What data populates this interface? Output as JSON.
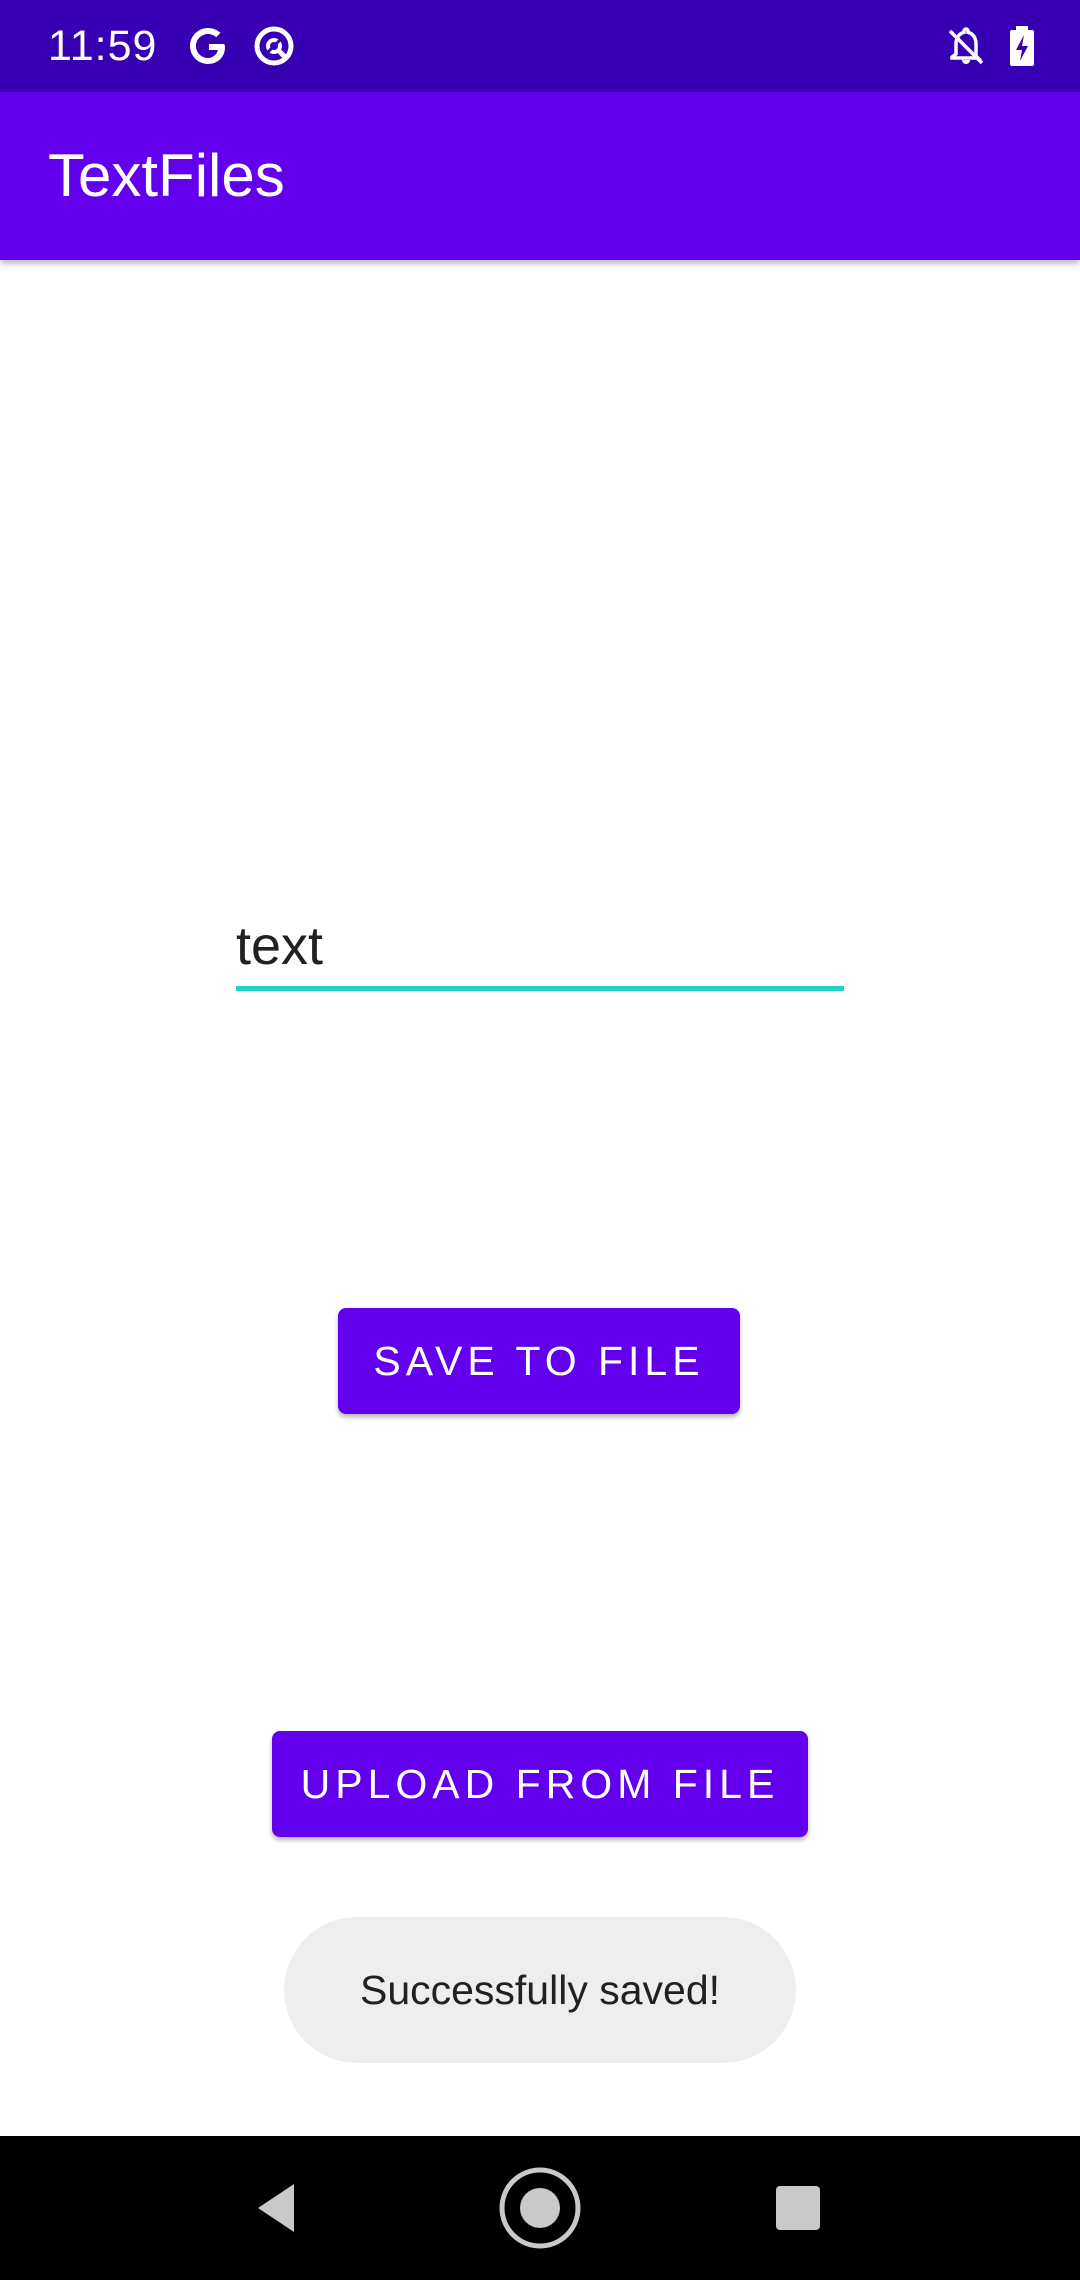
{
  "status_bar": {
    "time": "11:59",
    "left_icons": [
      "google-icon",
      "data-saver-icon"
    ],
    "right_icons": [
      "notifications-off-icon",
      "battery-charging-icon"
    ]
  },
  "app_bar": {
    "title": "TextFiles"
  },
  "text_field": {
    "value": "text"
  },
  "buttons": {
    "save": "SAVE TO FILE",
    "upload": "UPLOAD FROM FILE"
  },
  "toast": {
    "message": "Successfully saved!"
  },
  "nav_bar": {
    "icons": [
      "back-icon",
      "home-icon",
      "recents-icon"
    ]
  },
  "colors": {
    "status_bar": "#3700b3",
    "primary": "#6200ee",
    "accent": "#22d3c7",
    "toast_bg": "#eeeeee"
  }
}
